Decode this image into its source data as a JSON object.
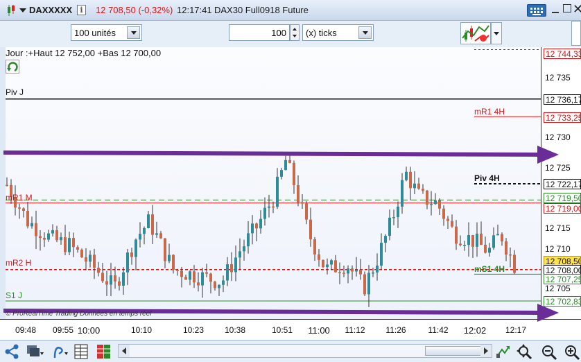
{
  "titlebar": {
    "instrument": "DAXXXXX",
    "price_change": "12 708,50 (-0,32%)",
    "time": "12:17:41",
    "description": "DAX30 Full0918 Future"
  },
  "toolbar": {
    "units_select": "100 unités",
    "quantity": "100",
    "ticks_select": "(x) ticks"
  },
  "chart": {
    "header": "Jour :+Haut 12 752,00 +Bas 12 700,00",
    "watermark": "© ProRealTime Trading  Données en temps réel",
    "y_ticks": [
      "12 735",
      "12 730",
      "12 725",
      "12 715",
      "12 710",
      "12 705"
    ],
    "x_ticks": [
      "09:48",
      "09:55",
      "10:00",
      "10:10",
      "10:23",
      "10:38",
      "10:51",
      "11:00",
      "11:12",
      "11:26",
      "11:42",
      "12:02",
      "12:17"
    ],
    "levels": {
      "piv_j": "Piv J",
      "mr1_4h": "mR1 4H",
      "piv_4h": "Piv 4H",
      "mr1_m": "mR1 M",
      "mr2_h": "mR2 H",
      "ms1_4h": "mS1 4H",
      "s1_j": "S1 J"
    },
    "price_boxes": {
      "top_red": "12 744,33",
      "piv_j": "12 736,17",
      "mr1_4h": "12 733,25",
      "piv_4h": "12 722,17",
      "green_dash": "12 719,50",
      "red_solid": "12 719,00",
      "last_yellow": "12 708,50",
      "red_dash": "12 708,00",
      "ms1_4h": "12 707,25",
      "s1_j": "12 702,83"
    },
    "colors": {
      "up_candle": "#2e8b9a",
      "down_candle": "#c9694a",
      "arrow": "#6a2c96",
      "red_level": "#e01010",
      "green_level": "#2a8a2a",
      "black_level": "#111111"
    }
  }
}
